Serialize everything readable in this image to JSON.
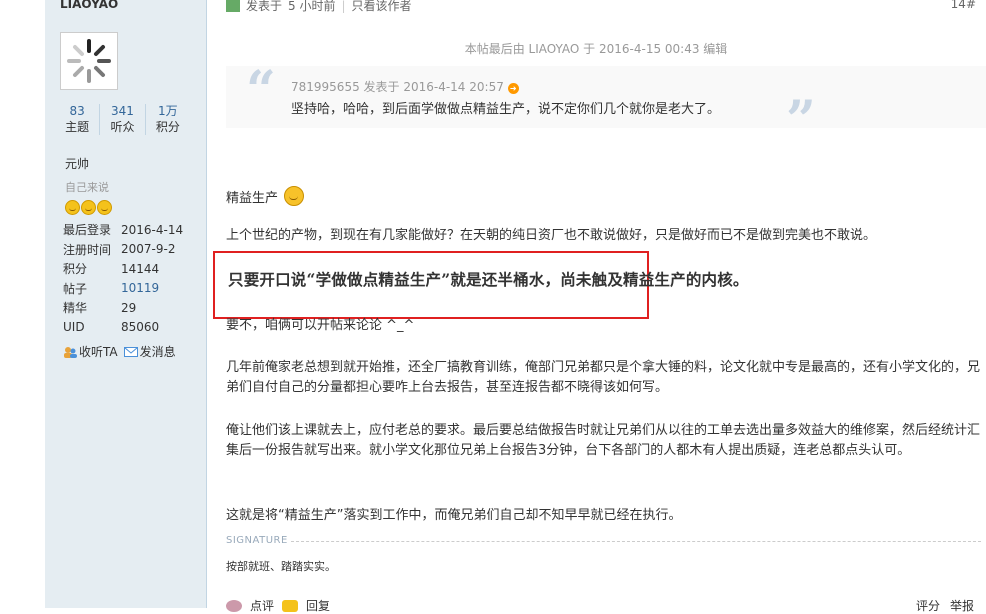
{
  "user": {
    "name": "LIAOYAO",
    "stats": [
      {
        "value": "83",
        "label": "主题"
      },
      {
        "value": "341",
        "label": "听众"
      },
      {
        "value": "1万",
        "label": "积分"
      }
    ],
    "rank": "元帅",
    "custom_title": "自己来说",
    "info": [
      {
        "key": "最后登录",
        "value": "2016-4-14"
      },
      {
        "key": "注册时间",
        "value": "2007-9-2"
      },
      {
        "key": "积分",
        "value": "14144"
      },
      {
        "key": "帖子",
        "value": "10119"
      },
      {
        "key": "精华",
        "value": "29"
      },
      {
        "key": "UID",
        "value": "85060"
      }
    ],
    "follow_label": "收听TA",
    "message_label": "发消息"
  },
  "post": {
    "posted_label": "发表于",
    "posted_time": "5 小时前",
    "only_author": "只看该作者",
    "floor": "14#",
    "edit_note": "本帖最后由 LIAOYAO 于 2016-4-15 00:43 编辑",
    "quote": {
      "header": "781995655 发表于 2016-4-14 20:57",
      "body": "坚持哈，哈哈，到后面学做做点精益生产，说不定你们几个就你是老大了。"
    },
    "section_title": "精益生产",
    "para1": "上个世纪的产物，到现在有几家能做好？在天朝的纯日资厂也不敢说做好，只是做好而已不是做到完美也不敢说。",
    "highlight": "只要开口说“学做做点精益生产”就是还半桶水，尚未触及精益生产的内核。",
    "para2": "要不，咱俩可以开帖来论论 ^_^",
    "para3": "几年前俺家老总想到就开始推，还全厂搞教育训练，俺部门兄弟都只是个拿大锤的料，论文化就中专是最高的，还有小学文化的，兄弟们自付自己的分量都担心要咋上台去报告，甚至连报告都不晓得该如何写。",
    "para4": "俺让他们该上课就去上，应付老总的要求。最后要总结做报告时就让兄弟们从以往的工单去选出量多效益大的维修案，然后经统计汇集后一份报告就写出来。就小学文化那位兄弟上台报告3分钟，台下各部门的人都木有人提出质疑，连老总都点头认可。",
    "para5": "这就是将“精益生产”落实到工作中，而俺兄弟们自己却不知早早就已经在执行。",
    "signature_label": "SIGNATURE",
    "signature": "按部就班、踏踏实实。",
    "bottom_left": [
      "点评",
      "回复"
    ],
    "bottom_right": [
      "评分",
      "举报"
    ]
  }
}
